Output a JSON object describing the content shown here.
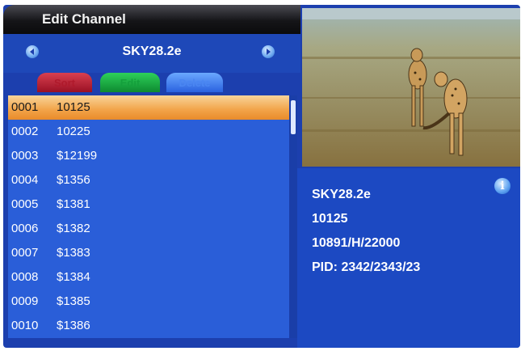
{
  "header": {
    "title": "Edit Channel"
  },
  "satellite": {
    "name": "SKY28.2e"
  },
  "buttons": {
    "sort": "Sort",
    "edit": "Edit",
    "delete": "Delete"
  },
  "channels": [
    {
      "num": "0001",
      "name": "10125",
      "selected": true
    },
    {
      "num": "0002",
      "name": "10225"
    },
    {
      "num": "0003",
      "name": "$12199"
    },
    {
      "num": "0004",
      "name": "$1356"
    },
    {
      "num": "0005",
      "name": "$1381"
    },
    {
      "num": "0006",
      "name": "$1382"
    },
    {
      "num": "0007",
      "name": "$1383"
    },
    {
      "num": "0008",
      "name": "$1384"
    },
    {
      "num": "0009",
      "name": "$1385"
    },
    {
      "num": "0010",
      "name": "$1386"
    }
  ],
  "info": {
    "satellite": "SKY28.2e",
    "channel": "10125",
    "transponder": "10891/H/22000",
    "pid": "PID: 2342/2343/23"
  },
  "icons": {
    "prev": "chevron-left-icon",
    "next": "chevron-right-icon",
    "info": "info-icon"
  },
  "colors": {
    "background": "#1c3fae",
    "list": "#2a5ed8",
    "selected": "#f2a348",
    "sort_button": "#c8283c",
    "edit_button": "#1ab446",
    "delete_button": "#4a86f2"
  }
}
